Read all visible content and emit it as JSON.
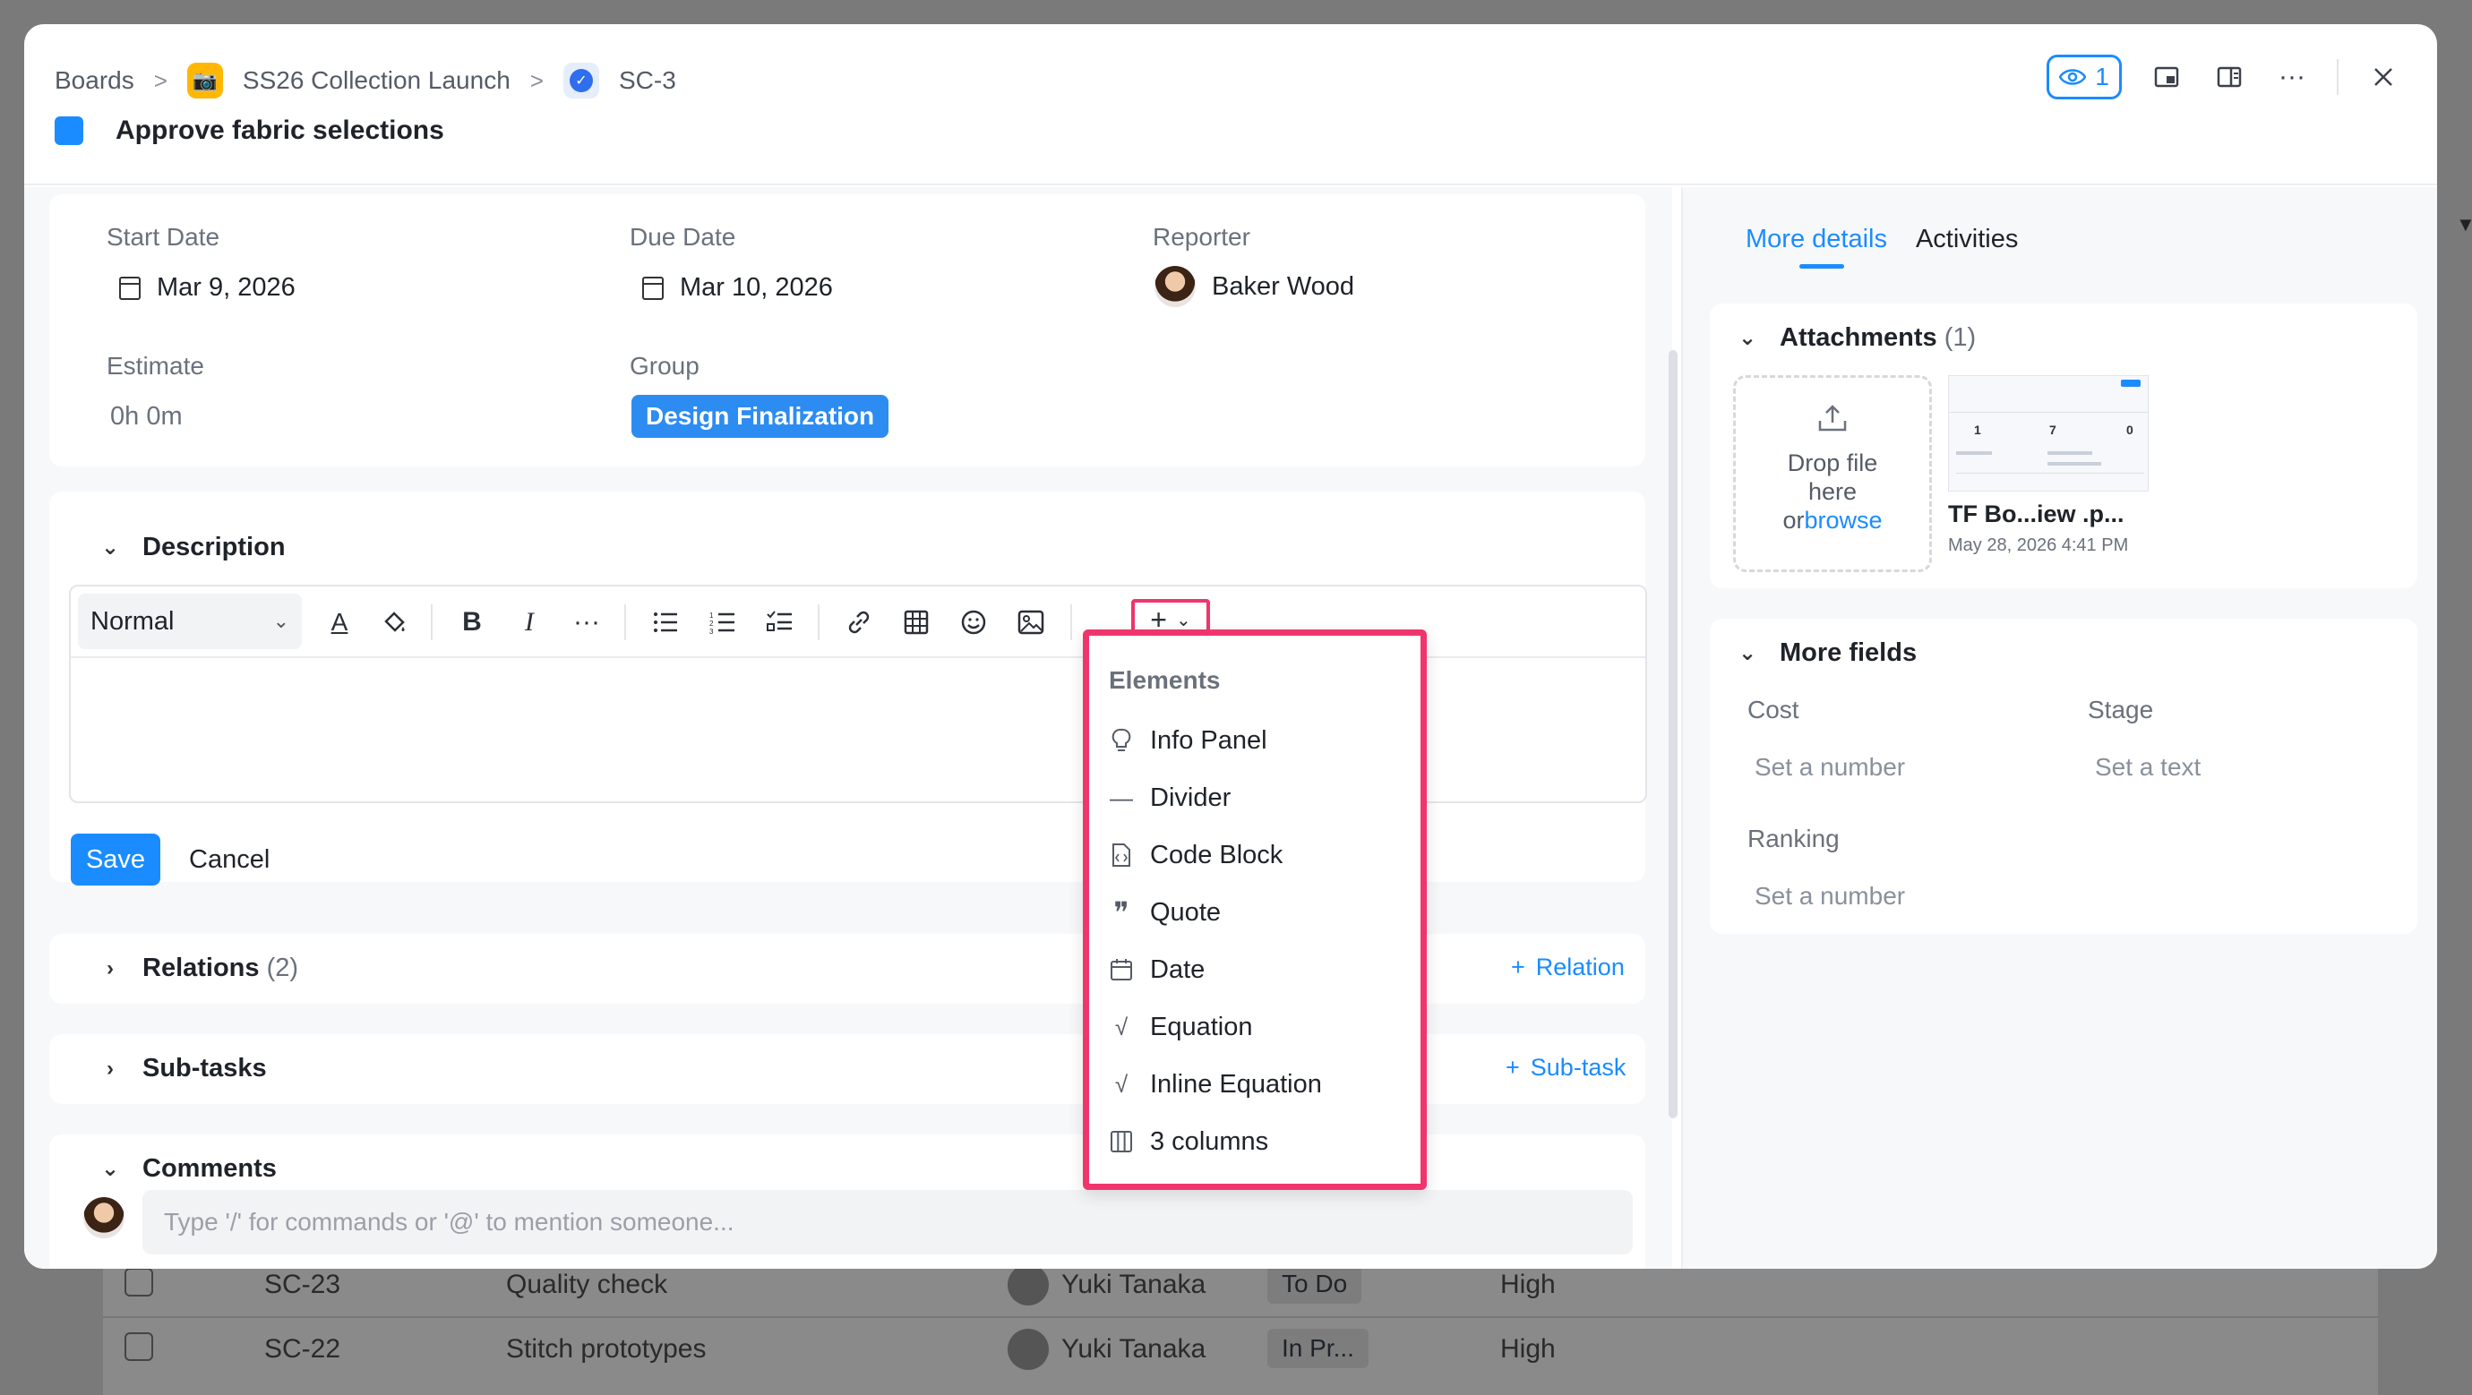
{
  "background_table": {
    "rows": [
      {
        "key": "SC-23",
        "title": "Quality check",
        "assignee": "Yuki Tanaka",
        "status": "To Do",
        "priority": "High"
      },
      {
        "key": "SC-22",
        "title": "Stitch prototypes",
        "assignee": "Yuki Tanaka",
        "status": "In Pr...",
        "priority": "High"
      }
    ]
  },
  "header": {
    "breadcrumb": {
      "root": "Boards",
      "project": "SS26 Collection Launch",
      "issue_key": "SC-3"
    },
    "title": "Approve fabric selections",
    "viewer_count": "1",
    "icons": [
      "eye-icon",
      "window-icon",
      "sidebar-icon",
      "more-icon",
      "close-icon"
    ]
  },
  "fields": {
    "start_date": {
      "label": "Start Date",
      "value": "Mar 9, 2026"
    },
    "due_date": {
      "label": "Due Date",
      "value": "Mar 10, 2026"
    },
    "reporter": {
      "label": "Reporter",
      "value": "Baker Wood"
    },
    "estimate": {
      "label": "Estimate",
      "value": "0h 0m"
    },
    "group": {
      "label": "Group",
      "value": "Design Finalization"
    }
  },
  "description": {
    "title": "Description",
    "style_select": "Normal",
    "save_label": "Save",
    "cancel_label": "Cancel"
  },
  "insert_menu": {
    "heading": "Elements",
    "items": [
      {
        "label": "Info Panel",
        "icon": "lightbulb-icon"
      },
      {
        "label": "Divider",
        "icon": "divider-icon"
      },
      {
        "label": "Code Block",
        "icon": "code-file-icon"
      },
      {
        "label": "Quote",
        "icon": "quote-icon"
      },
      {
        "label": "Date",
        "icon": "calendar-icon"
      },
      {
        "label": "Equation",
        "icon": "sqrt-icon"
      },
      {
        "label": "Inline Equation",
        "icon": "sqrt-icon"
      },
      {
        "label": "3 columns",
        "icon": "columns-icon"
      }
    ]
  },
  "relations": {
    "title": "Relations",
    "count": "(2)",
    "add_label": "Relation"
  },
  "subtasks": {
    "title": "Sub-tasks",
    "add_label": "Sub-task"
  },
  "comments": {
    "title": "Comments",
    "placeholder": "Type '/' for commands or '@' to mention someone..."
  },
  "right_panel": {
    "tabs": [
      "More details",
      "Activities"
    ],
    "attachments": {
      "title": "Attachments",
      "count": "(1)",
      "drop_text_1": "Drop file",
      "drop_text_2": "here",
      "drop_text_or": "or",
      "drop_text_browse": "browse",
      "file_name": "TF Bo...iew .p...",
      "file_date": "May 28, 2026 4:41 PM",
      "thumb_numbers": [
        "1",
        "7",
        "0"
      ]
    },
    "more_fields": {
      "title": "More fields",
      "cost_label": "Cost",
      "cost_placeholder": "Set a number",
      "stage_label": "Stage",
      "stage_placeholder": "Set a text",
      "ranking_label": "Ranking",
      "ranking_placeholder": "Set a number"
    }
  },
  "colors": {
    "accent": "#1a8cff",
    "highlight": "#f0356d",
    "group_badge": "#2c8cf2"
  }
}
